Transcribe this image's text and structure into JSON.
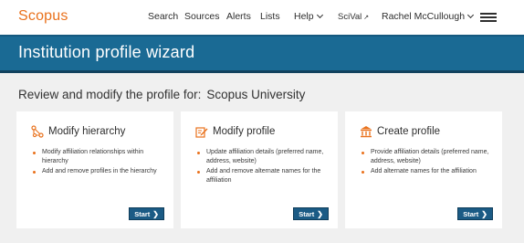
{
  "header": {
    "brand": "Scopus",
    "nav": {
      "search": "Search",
      "sources": "Sources",
      "alerts": "Alerts",
      "lists": "Lists",
      "help": "Help",
      "scival": "SciVal",
      "scival_icon": "↗",
      "user": "Rachel McCullough"
    }
  },
  "banner": {
    "title": "Institution profile wizard"
  },
  "review": {
    "prefix": "Review and modify the profile for:",
    "institution": "Scopus University"
  },
  "cards": [
    {
      "title": "Modify hierarchy",
      "icon": "hierarchy-icon",
      "bullets": [
        "Modify affiliation relationships within hierarchy",
        "Add and remove profiles in the hierarchy"
      ],
      "button": "Start"
    },
    {
      "title": "Modify profile",
      "icon": "edit-profile-icon",
      "bullets": [
        "Update affiliation details (preferred name, address, website)",
        "Add and remove alternate names for the affiliation"
      ],
      "button": "Start"
    },
    {
      "title": "Create profile",
      "icon": "institution-icon",
      "bullets": [
        "Provide affiliation details (preferred name, address, website)",
        "Add alternate names for the affiliation"
      ],
      "button": "Start"
    }
  ],
  "colors": {
    "brand": "#e9711c",
    "banner": "#1a6a94",
    "button": "#1b5b85",
    "bullet": "#e9711c"
  }
}
